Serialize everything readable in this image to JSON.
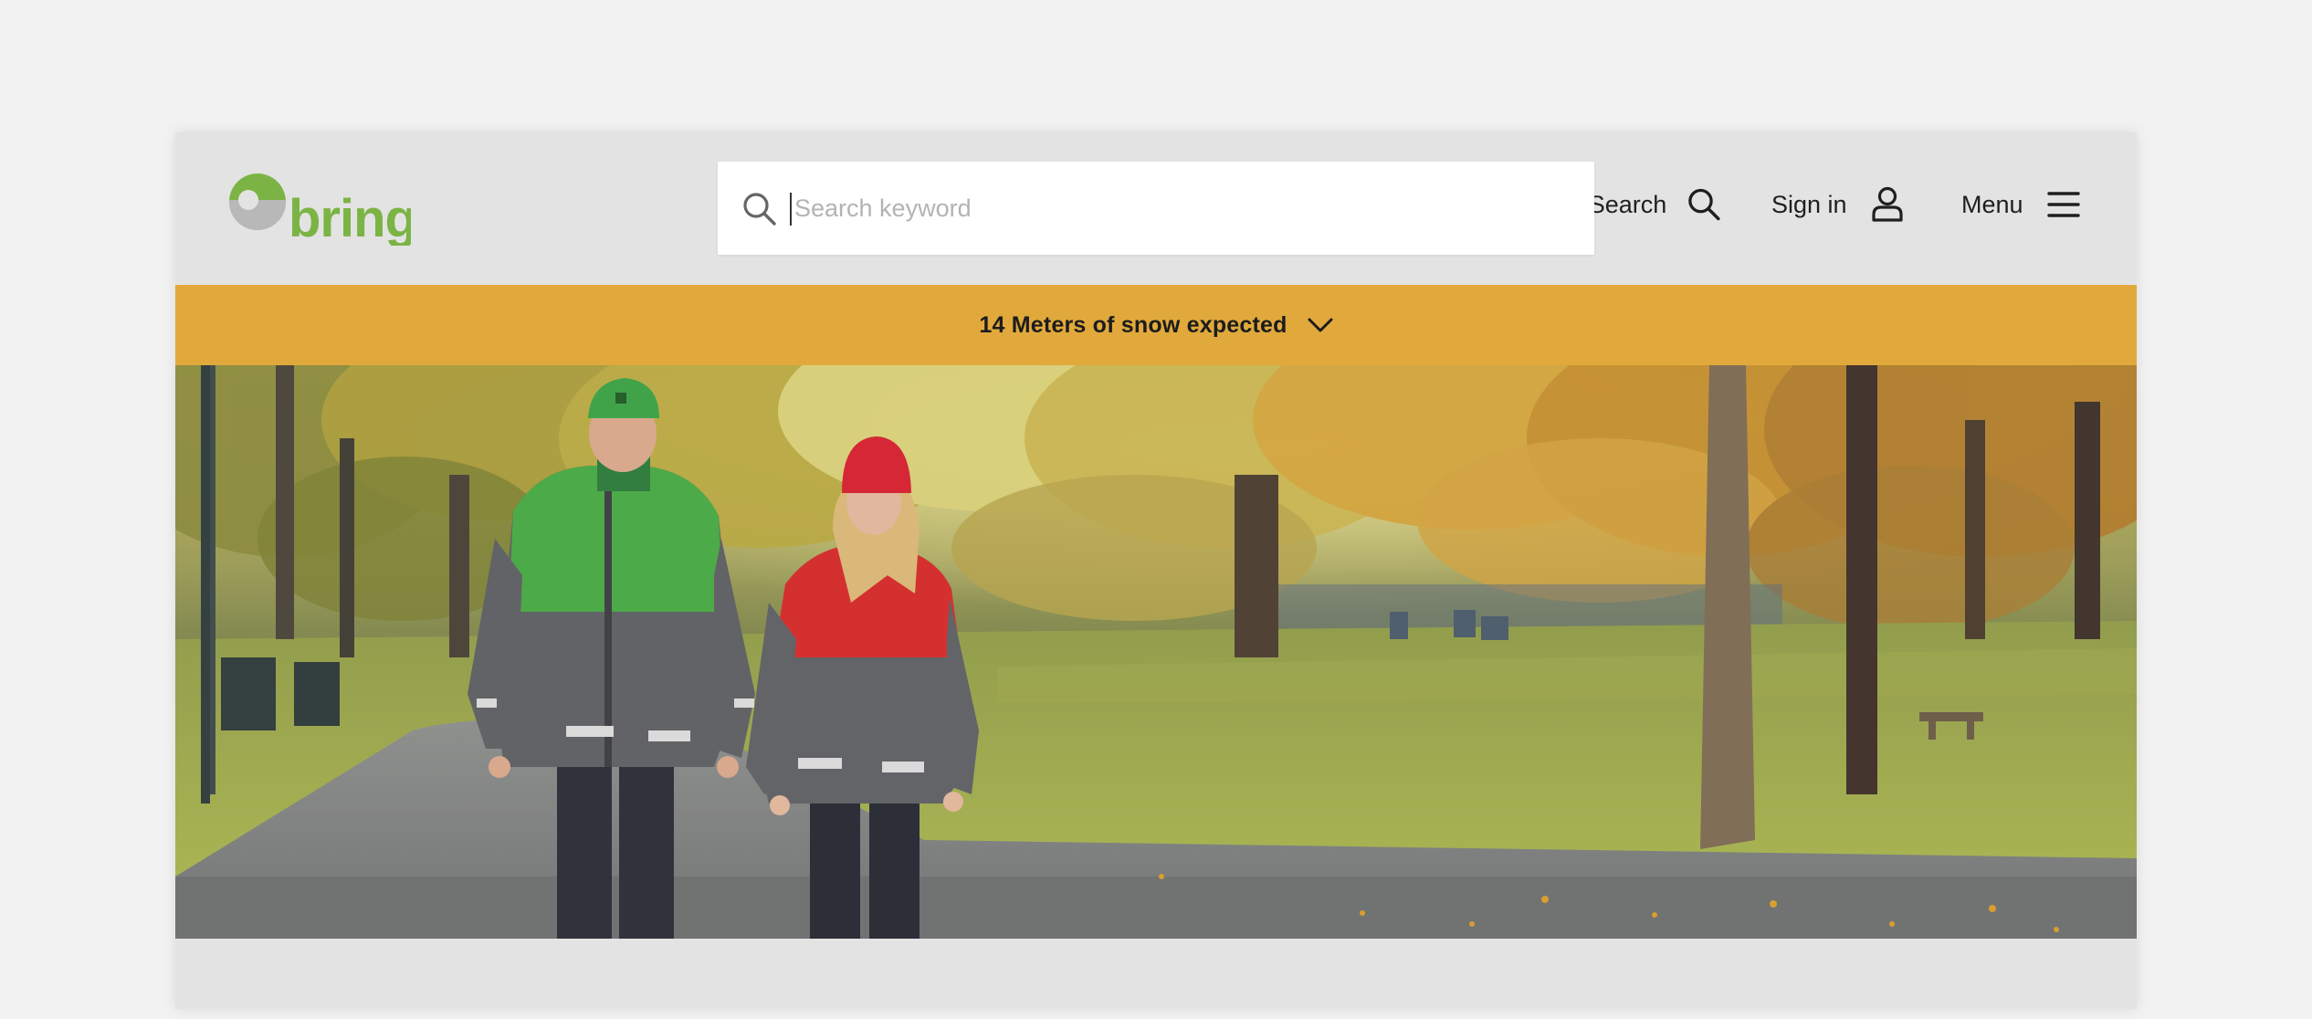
{
  "brand": {
    "name": "bring",
    "logo_green": "#7bb445",
    "logo_gray": "#b8b8b8"
  },
  "search": {
    "placeholder": "Search keyword",
    "value": ""
  },
  "nav": {
    "search_label": "Search",
    "signin_label": "Sign in",
    "menu_label": "Menu"
  },
  "alert": {
    "text": "14 Meters of snow expected",
    "background": "#e1a93c"
  },
  "hero": {
    "description_icons": [
      "search-icon",
      "user-icon",
      "hamburger-icon",
      "chevron-down-icon"
    ]
  }
}
